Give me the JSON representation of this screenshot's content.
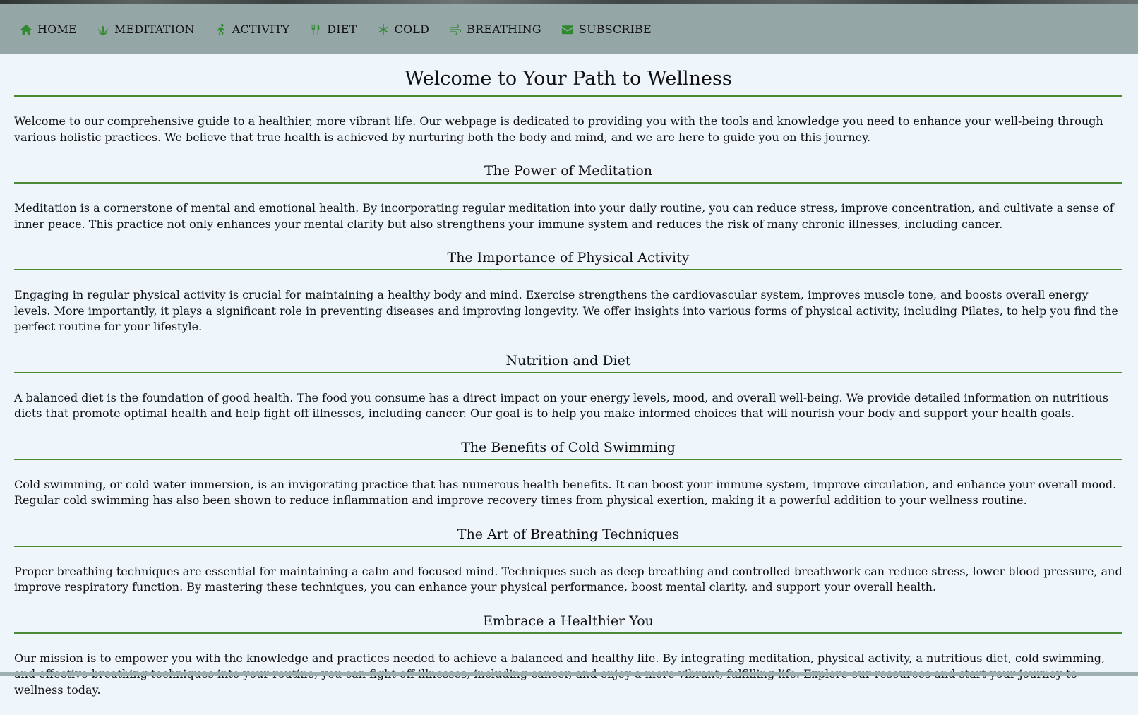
{
  "nav": {
    "items": [
      {
        "label": "HOME",
        "icon": "home-icon"
      },
      {
        "label": "MEDITATION",
        "icon": "lotus-icon"
      },
      {
        "label": "ACTIVITY",
        "icon": "running-icon"
      },
      {
        "label": "DIET",
        "icon": "utensils-icon"
      },
      {
        "label": "COLD",
        "icon": "snowflake-icon"
      },
      {
        "label": "BREATHING",
        "icon": "wind-icon"
      },
      {
        "label": "SUBSCRIBE",
        "icon": "envelope-icon"
      }
    ],
    "icon_color": "#2f8a2f",
    "background": "#95a6a6"
  },
  "page": {
    "title": "Welcome to Your Path to Wellness",
    "intro": "Welcome to our comprehensive guide to a healthier, more vibrant life. Our webpage is dedicated to providing you with the tools and knowledge you need to enhance your well-being through various holistic practices. We believe that true health is achieved by nurturing both the body and mind, and we are here to guide you on this journey.",
    "accent": "#4a8a33",
    "background": "#eef5fb"
  },
  "sections": [
    {
      "heading": "The Power of Meditation",
      "text": "Meditation is a cornerstone of mental and emotional health. By incorporating regular meditation into your daily routine, you can reduce stress, improve concentration, and cultivate a sense of inner peace. This practice not only enhances your mental clarity but also strengthens your immune system and reduces the risk of many chronic illnesses, including cancer."
    },
    {
      "heading": "The Importance of Physical Activity",
      "text": "Engaging in regular physical activity is crucial for maintaining a healthy body and mind. Exercise strengthens the cardiovascular system, improves muscle tone, and boosts overall energy levels. More importantly, it plays a significant role in preventing diseases and improving longevity. We offer insights into various forms of physical activity, including Pilates, to help you find the perfect routine for your lifestyle."
    },
    {
      "heading": "Nutrition and Diet",
      "text": "A balanced diet is the foundation of good health. The food you consume has a direct impact on your energy levels, mood, and overall well-being. We provide detailed information on nutritious diets that promote optimal health and help fight off illnesses, including cancer. Our goal is to help you make informed choices that will nourish your body and support your health goals."
    },
    {
      "heading": "The Benefits of Cold Swimming",
      "text": "Cold swimming, or cold water immersion, is an invigorating practice that has numerous health benefits. It can boost your immune system, improve circulation, and enhance your overall mood. Regular cold swimming has also been shown to reduce inflammation and improve recovery times from physical exertion, making it a powerful addition to your wellness routine."
    },
    {
      "heading": "The Art of Breathing Techniques",
      "text": "Proper breathing techniques are essential for maintaining a calm and focused mind. Techniques such as deep breathing and controlled breathwork can reduce stress, lower blood pressure, and improve respiratory function. By mastering these techniques, you can enhance your physical performance, boost mental clarity, and support your overall health."
    },
    {
      "heading": "Embrace a Healthier You",
      "text": "Our mission is to empower you with the knowledge and practices needed to achieve a balanced and healthy life. By integrating meditation, physical activity, a nutritious diet, cold swimming, and effective breathing techniques into your routine, you can fight off illnesses, including cancer, and enjoy a more vibrant, fulfilling life. Explore our resources and start your journey to wellness today."
    }
  ]
}
